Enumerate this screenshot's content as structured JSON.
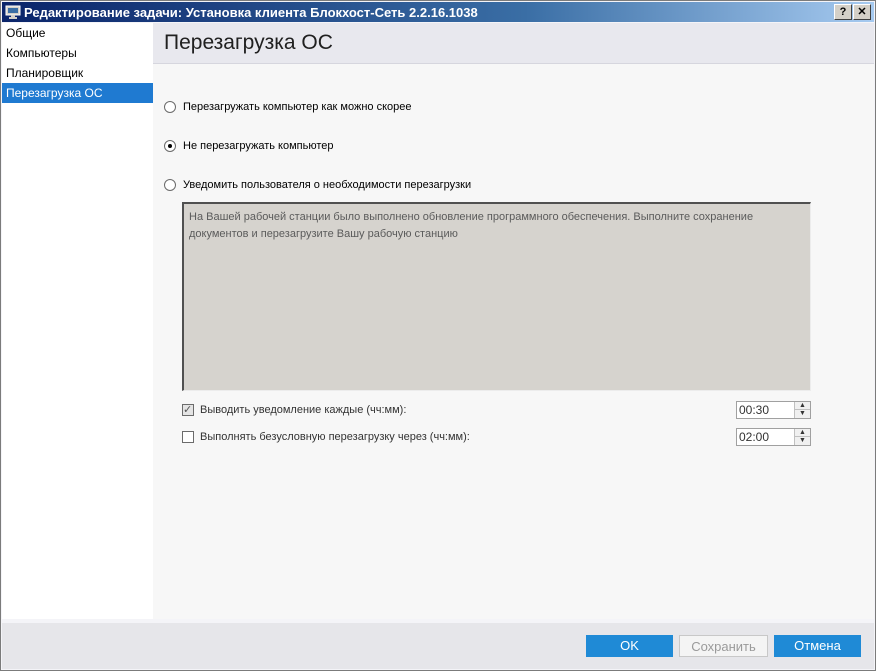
{
  "window": {
    "title": "Редактирование задачи: Установка клиента Блокхост-Сеть 2.2.16.1038",
    "help_label": "?",
    "close_label": "✕"
  },
  "sidebar": {
    "items": [
      {
        "label": "Общие"
      },
      {
        "label": "Компьютеры"
      },
      {
        "label": "Планировщик"
      },
      {
        "label": "Перезагрузка ОС",
        "active": true
      }
    ]
  },
  "page": {
    "title": "Перезагрузка ОС"
  },
  "options": {
    "restart_asap": {
      "label": "Перезагружать компьютер как можно скорее",
      "checked": false
    },
    "no_restart": {
      "label": "Не перезагружать компьютер",
      "checked": true
    },
    "notify_user": {
      "label": "Уведомить пользователя о необходимости перезагрузки",
      "checked": false
    }
  },
  "notification": {
    "message": "На Вашей рабочей станции было выполнено обновление программного обеспечения. Выполните сохранение документов и перезагрузите Вашу рабочую станцию"
  },
  "notify_every": {
    "label": "Выводить уведомление каждые (чч:мм):",
    "checked": true,
    "value": "00:30"
  },
  "force_restart": {
    "label": "Выполнять безусловную перезагрузку через (чч:мм):",
    "checked": false,
    "value": "02:00"
  },
  "footer": {
    "ok_label": "OK",
    "save_label": "Сохранить",
    "cancel_label": "Отмена"
  }
}
